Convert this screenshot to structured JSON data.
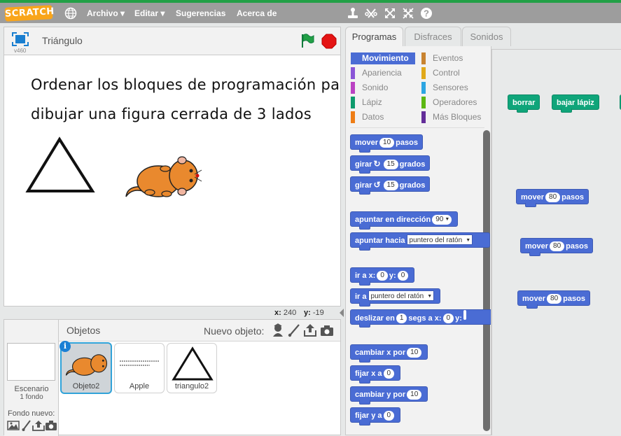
{
  "menubar": {
    "logo": "SCRATCH",
    "items": [
      "Archivo",
      "Editar",
      "Sugerencias",
      "Acerca de"
    ]
  },
  "stage": {
    "version": "v460",
    "title": "Triángulo",
    "text_line1": "Ordenar los bloques de programación para",
    "text_line2": "dibujar una figura cerrada de 3 lados",
    "x_label": "x:",
    "x_value": "240",
    "y_label": "y:",
    "y_value": "-19"
  },
  "sprites": {
    "header": "Objetos",
    "new_object": "Nuevo objeto:",
    "scene_name": "Escenario",
    "scene_backdrops": "1 fondo",
    "new_backdrop": "Fondo nuevo:",
    "items": [
      {
        "name": "Objeto2",
        "selected": true
      },
      {
        "name": "Apple",
        "selected": false
      },
      {
        "name": "triangulo2",
        "selected": false
      }
    ],
    "info_badge": "i"
  },
  "tabs": [
    "Programas",
    "Disfraces",
    "Sonidos"
  ],
  "categories": [
    {
      "label": "Movimiento",
      "color": "#4a6cd4",
      "active": true
    },
    {
      "label": "Eventos",
      "color": "#c88330",
      "active": false
    },
    {
      "label": "Apariencia",
      "color": "#8a55d7",
      "active": false
    },
    {
      "label": "Control",
      "color": "#e1a91a",
      "active": false
    },
    {
      "label": "Sonido",
      "color": "#bb42c3",
      "active": false
    },
    {
      "label": "Sensores",
      "color": "#2ca5e2",
      "active": false
    },
    {
      "label": "Lápiz",
      "color": "#0e9a6c",
      "active": false
    },
    {
      "label": "Operadores",
      "color": "#5cb712",
      "active": false
    },
    {
      "label": "Datos",
      "color": "#ee7d16",
      "active": false
    },
    {
      "label": "Más Bloques",
      "color": "#632d99",
      "active": false
    }
  ],
  "palette_blocks": {
    "move": {
      "pre": "mover",
      "value": "10",
      "post": "pasos"
    },
    "turn_right": {
      "pre": "girar",
      "value": "15",
      "post": "grados"
    },
    "turn_left": {
      "pre": "girar",
      "value": "15",
      "post": "grados"
    },
    "point_dir": {
      "pre": "apuntar en dirección",
      "value": "90"
    },
    "point_towards": {
      "pre": "apuntar hacia",
      "value": "puntero del ratón"
    },
    "goto_xy": {
      "pre": "ir a x:",
      "x": "0",
      "mid": "y:",
      "y": "0"
    },
    "goto": {
      "pre": "ir a",
      "value": "puntero del ratón"
    },
    "glide": {
      "pre": "deslizar en",
      "secs": "1",
      "mid": "segs a x:",
      "x": "0",
      "y_label": "y:"
    },
    "change_x": {
      "pre": "cambiar x por",
      "value": "10"
    },
    "set_x": {
      "pre": "fijar x a",
      "value": "0"
    },
    "change_y": {
      "pre": "cambiar y por",
      "value": "10"
    },
    "set_y": {
      "pre": "fijar y a",
      "value": "0"
    }
  },
  "script_blocks": {
    "clear": "borrar",
    "pen_down": "bajar lápiz",
    "moves": [
      {
        "pre": "mover",
        "value": "80",
        "post": "pasos"
      },
      {
        "pre": "mover",
        "value": "80",
        "post": "pasos"
      },
      {
        "pre": "mover",
        "value": "80",
        "post": "pasos"
      }
    ]
  },
  "colors": {
    "motion": "#4a6cd4",
    "pen": "#0fa57a",
    "topbar": "#9d9d9d",
    "accent_green": "#22a046",
    "logo": "#f9a51a"
  }
}
